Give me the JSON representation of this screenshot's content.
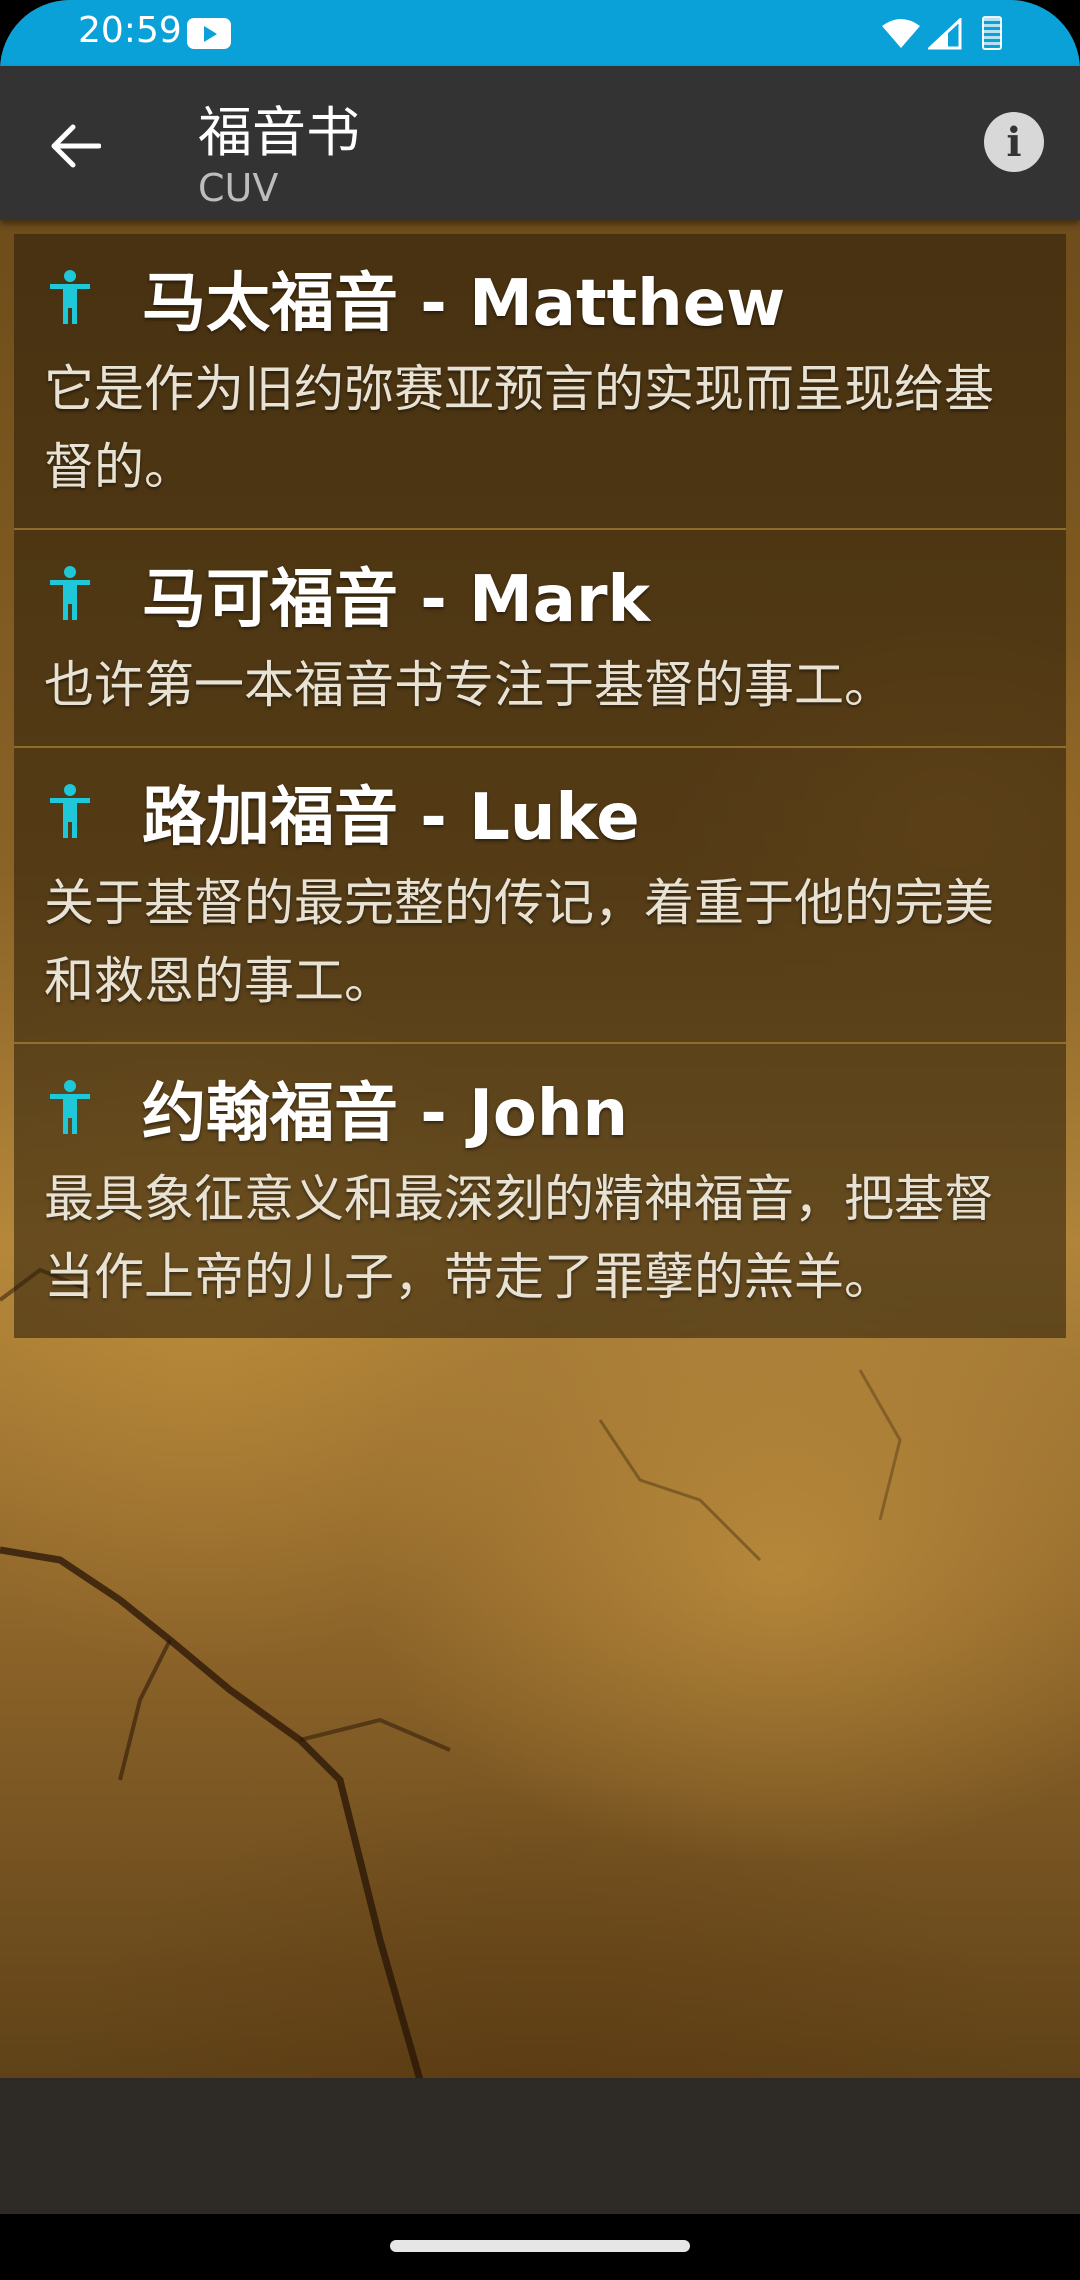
{
  "status_bar": {
    "time": "20:59",
    "icons": [
      "youtube-icon",
      "wifi-icon",
      "signal-icon",
      "battery-icon"
    ],
    "color": "#0aa0d8"
  },
  "app_bar": {
    "title": "福音书",
    "subtitle": "CUV",
    "back_icon": "arrow-left-icon",
    "info_icon": "info-icon",
    "info_glyph": "i"
  },
  "books": [
    {
      "icon": "person-accessibility-icon",
      "title": "马太福音 - Matthew",
      "description": "它是作为旧约弥赛亚预言的实现而呈现给基督的。"
    },
    {
      "icon": "person-accessibility-icon",
      "title": "马可福音 - Mark",
      "description": "也许第一本福音书专注于基督的事工。"
    },
    {
      "icon": "person-accessibility-icon",
      "title": "路加福音 - Luke",
      "description": "关于基督的最完整的传记，着重于他的完美和救恩的事工。"
    },
    {
      "icon": "person-accessibility-icon",
      "title": "约翰福音 - John",
      "description": "最具象征意义和最深刻的精神福音，把基督当作上帝的儿子，带走了罪孽的羔羊。"
    }
  ],
  "colors": {
    "app_bar": "#333333",
    "icon_accent": "#1ec8d8",
    "divider": "#aa8232"
  }
}
